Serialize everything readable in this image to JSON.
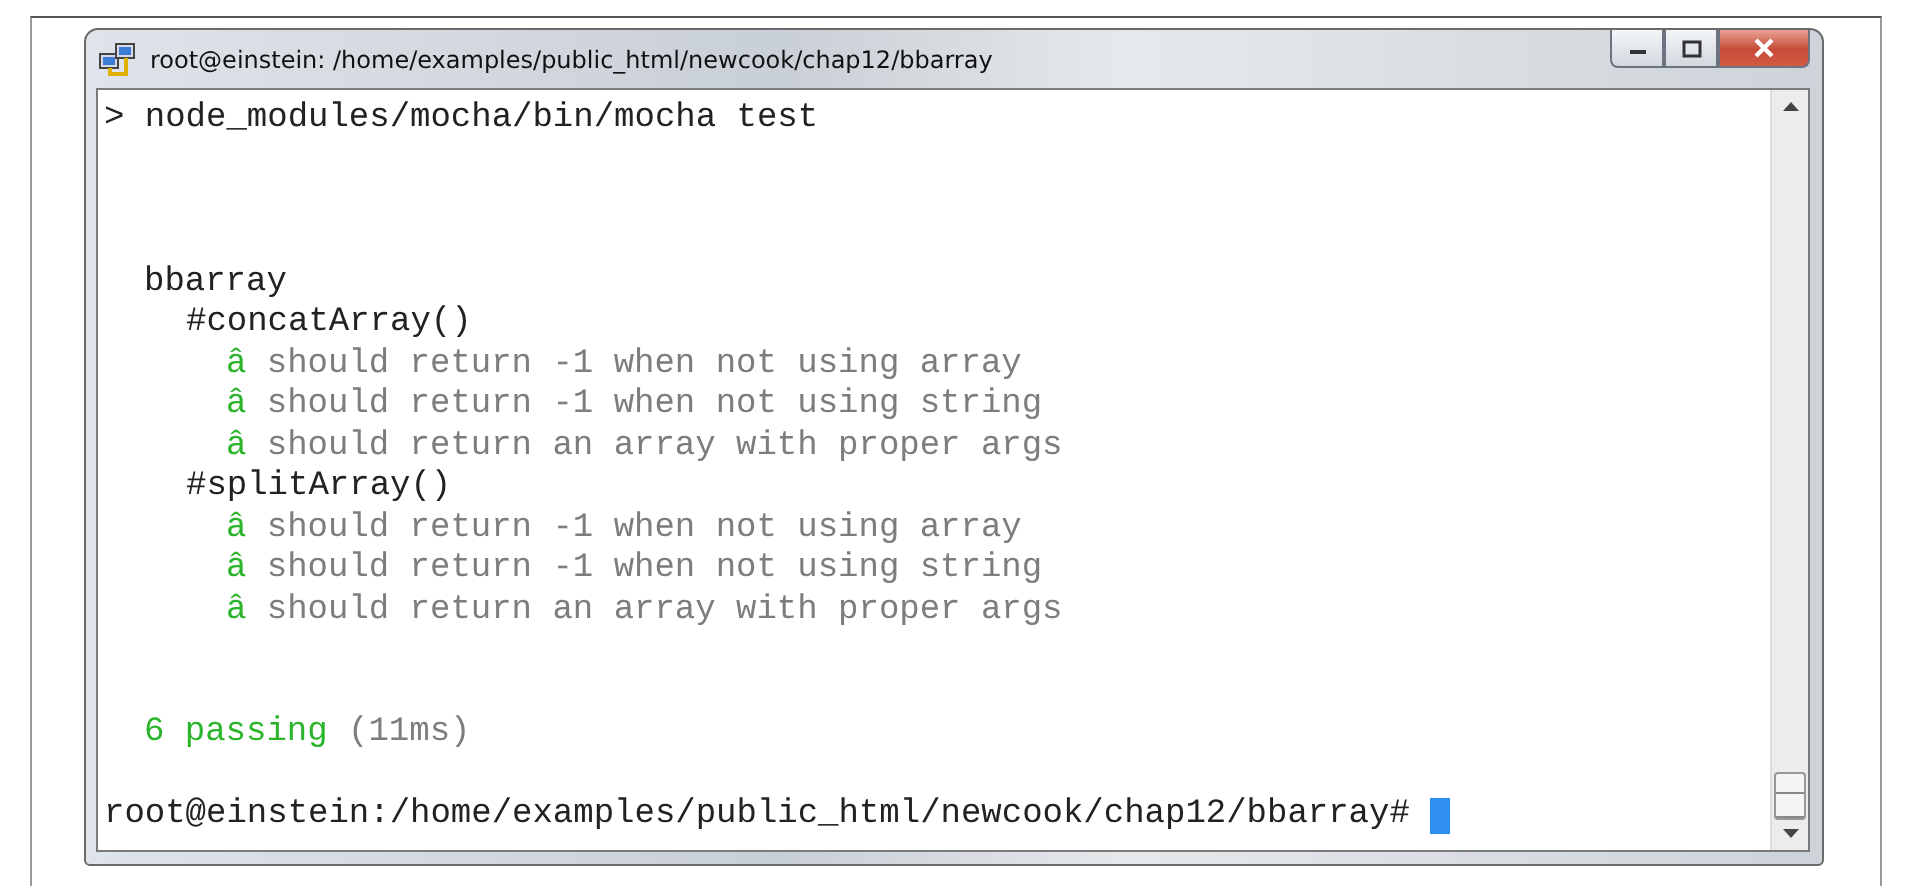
{
  "window": {
    "title": "root@einstein: /home/examples/public_html/newcook/chap12/bbarray"
  },
  "terminal": {
    "command": "> node_modules/mocha/bin/mocha test",
    "suite": {
      "name": "bbarray",
      "groups": [
        {
          "name": "#concatArray()",
          "tests": [
            {
              "mark": "â",
              "text": "should return -1 when not using array"
            },
            {
              "mark": "â",
              "text": "should return -1 when not using string"
            },
            {
              "mark": "â",
              "text": "should return an array with proper args"
            }
          ]
        },
        {
          "name": "#splitArray()",
          "tests": [
            {
              "mark": "â",
              "text": "should return -1 when not using array"
            },
            {
              "mark": "â",
              "text": "should return -1 when not using string"
            },
            {
              "mark": "â",
              "text": "should return an array with proper args"
            }
          ]
        }
      ]
    },
    "summary": {
      "passing": "6 passing",
      "duration": "(11ms)"
    },
    "prompt": "root@einstein:/home/examples/public_html/newcook/chap12/bbarray#"
  }
}
